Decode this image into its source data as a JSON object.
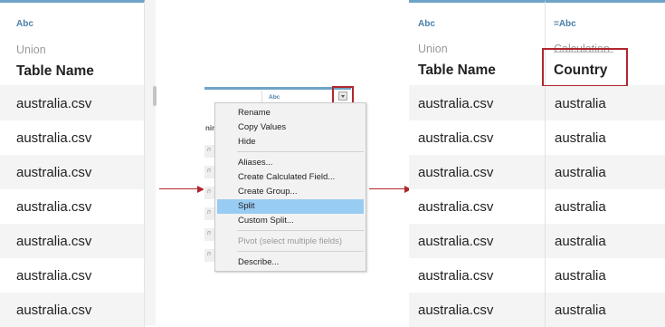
{
  "left": {
    "type": "Abc",
    "origin": "Union",
    "header": "Table Name",
    "rows": [
      "australia.csv",
      "australia.csv",
      "australia.csv",
      "australia.csv",
      "australia.csv",
      "australia.csv",
      "australia.csv"
    ]
  },
  "middle": {
    "type": "Abc",
    "ghost_header": "nin",
    "ghost_rows": [
      "n",
      "n",
      "n",
      "n",
      "n",
      "n"
    ],
    "menu": [
      "Rename",
      "Copy Values",
      "Hide",
      "Aliases...",
      "Create Calculated Field...",
      "Create Group...",
      "Split",
      "Custom Split...",
      "Pivot (select multiple fields)",
      "Describe..."
    ]
  },
  "right": {
    "col1": {
      "type": "Abc",
      "origin": "Union",
      "header": "Table Name",
      "rows": [
        "australia.csv",
        "australia.csv",
        "australia.csv",
        "australia.csv",
        "australia.csv",
        "australia.csv",
        "australia.csv"
      ]
    },
    "col2": {
      "type": "=Abc",
      "origin": "Calculation",
      "header": "Country",
      "rows": [
        "australia",
        "australia",
        "australia",
        "australia",
        "australia",
        "australia",
        "australia"
      ]
    }
  },
  "colors": {
    "accent": "#6fa3c7",
    "highlight": "#b1272f",
    "menu_selected": "#99ccf3"
  }
}
